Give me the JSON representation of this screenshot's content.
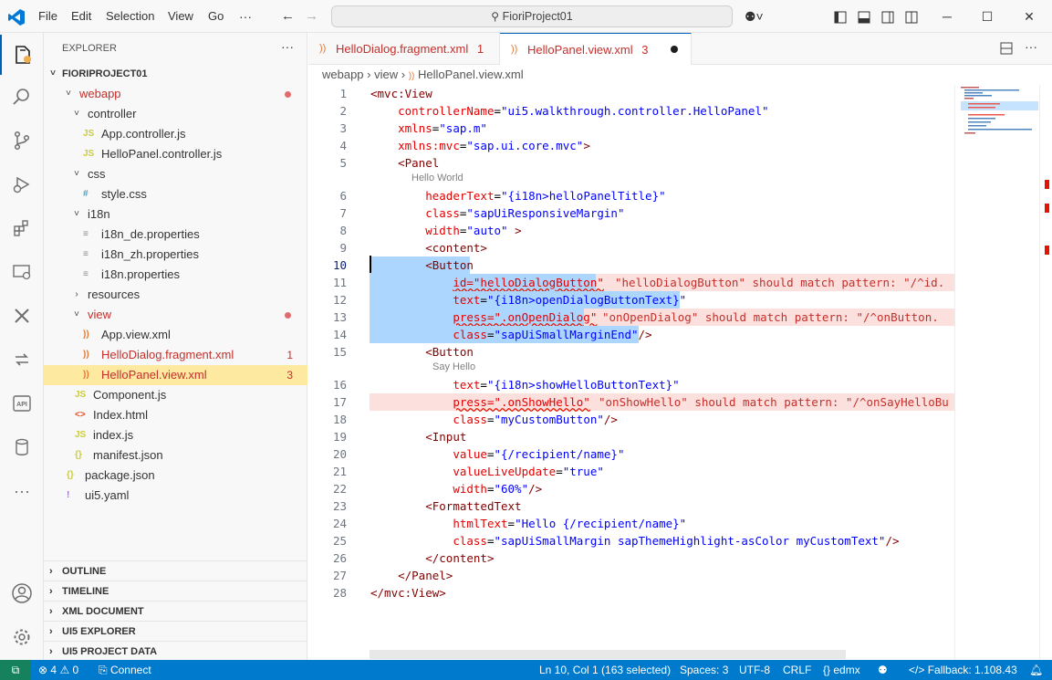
{
  "titlebar": {
    "menu": [
      "File",
      "Edit",
      "Selection",
      "View",
      "Go"
    ],
    "more": "···",
    "search": "FioriProject01"
  },
  "activity_icons": [
    "explorer-icon",
    "search-icon",
    "source-control-icon",
    "run-debug-icon",
    "extensions-icon",
    "remote-explorer-icon",
    "sap-tools-icon",
    "deploy-icon",
    "api-icon",
    "database-icon",
    "more-icon",
    "account-icon",
    "settings-icon"
  ],
  "sidebar": {
    "title": "EXPLORER",
    "project": "FIORIPROJECT01",
    "tree": [
      {
        "label": "webapp",
        "type": "folder",
        "open": true,
        "depth": 1,
        "color": "#c4302b",
        "dot": true
      },
      {
        "label": "controller",
        "type": "folder",
        "open": true,
        "depth": 2
      },
      {
        "label": "App.controller.js",
        "type": "js",
        "depth": 3
      },
      {
        "label": "HelloPanel.controller.js",
        "type": "js",
        "depth": 3
      },
      {
        "label": "css",
        "type": "folder",
        "open": true,
        "depth": 2
      },
      {
        "label": "style.css",
        "type": "css",
        "depth": 3
      },
      {
        "label": "i18n",
        "type": "folder",
        "open": true,
        "depth": 2
      },
      {
        "label": "i18n_de.properties",
        "type": "prop",
        "depth": 3
      },
      {
        "label": "i18n_zh.properties",
        "type": "prop",
        "depth": 3
      },
      {
        "label": "i18n.properties",
        "type": "prop",
        "depth": 3
      },
      {
        "label": "resources",
        "type": "folder",
        "open": false,
        "depth": 2
      },
      {
        "label": "view",
        "type": "folder",
        "open": true,
        "depth": 2,
        "color": "#c4302b",
        "dot": true
      },
      {
        "label": "App.view.xml",
        "type": "xml",
        "depth": 3
      },
      {
        "label": "HelloDialog.fragment.xml",
        "type": "xml",
        "depth": 3,
        "color": "#c4302b",
        "badge": "1"
      },
      {
        "label": "HelloPanel.view.xml",
        "type": "xml",
        "depth": 3,
        "color": "#c4302b",
        "badge": "3",
        "selected": true
      },
      {
        "label": "Component.js",
        "type": "js",
        "depth": 2
      },
      {
        "label": "Index.html",
        "type": "html",
        "depth": 2
      },
      {
        "label": "index.js",
        "type": "js",
        "depth": 2
      },
      {
        "label": "manifest.json",
        "type": "json",
        "depth": 2
      },
      {
        "label": "package.json",
        "type": "json",
        "depth": 1
      },
      {
        "label": "ui5.yaml",
        "type": "yaml",
        "depth": 1
      }
    ],
    "panels": [
      "OUTLINE",
      "TIMELINE",
      "XML DOCUMENT",
      "UI5 EXPLORER",
      "UI5 PROJECT DATA"
    ]
  },
  "tabs": [
    {
      "label": "HelloDialog.fragment.xml",
      "badge": "1",
      "active": false
    },
    {
      "label": "HelloPanel.view.xml",
      "badge": "3",
      "active": true,
      "dirty": true
    }
  ],
  "breadcrumb": [
    "webapp",
    "view",
    "HelloPanel.view.xml"
  ],
  "code": {
    "lines": [
      {
        "n": "1",
        "parts": [
          [
            "t",
            "<mvc:View"
          ]
        ]
      },
      {
        "n": "2",
        "parts": [
          [
            "x",
            "    "
          ],
          [
            "a",
            "controllerName"
          ],
          [
            "x",
            "="
          ],
          [
            "v",
            "\"ui5.walkthrough.controller.HelloPanel\""
          ]
        ]
      },
      {
        "n": "3",
        "parts": [
          [
            "x",
            "    "
          ],
          [
            "a",
            "xmlns"
          ],
          [
            "x",
            "="
          ],
          [
            "v",
            "\"sap.m\""
          ]
        ]
      },
      {
        "n": "4",
        "parts": [
          [
            "x",
            "    "
          ],
          [
            "a",
            "xmlns:mvc"
          ],
          [
            "x",
            "="
          ],
          [
            "v",
            "\"sap.ui.core.mvc\""
          ],
          [
            "t",
            ">"
          ]
        ]
      },
      {
        "n": "5",
        "parts": [
          [
            "x",
            "    "
          ],
          [
            "t",
            "<Panel"
          ]
        ]
      },
      {
        "hint": "Hello World"
      },
      {
        "n": "6",
        "parts": [
          [
            "x",
            "        "
          ],
          [
            "a",
            "headerText"
          ],
          [
            "x",
            "="
          ],
          [
            "v",
            "\"{i18n>helloPanelTitle}\""
          ]
        ]
      },
      {
        "n": "7",
        "parts": [
          [
            "x",
            "        "
          ],
          [
            "a",
            "class"
          ],
          [
            "x",
            "="
          ],
          [
            "v",
            "\"sapUiResponsiveMargin\""
          ]
        ]
      },
      {
        "n": "8",
        "parts": [
          [
            "x",
            "        "
          ],
          [
            "a",
            "width"
          ],
          [
            "x",
            "="
          ],
          [
            "v",
            "\"auto\""
          ],
          [
            "x",
            " "
          ],
          [
            "t",
            ">"
          ]
        ]
      },
      {
        "n": "9",
        "parts": [
          [
            "x",
            "        "
          ],
          [
            "t",
            "<content>"
          ]
        ]
      },
      {
        "n": "10",
        "parts": [
          [
            "x",
            "        "
          ],
          [
            "t",
            "<Button"
          ]
        ],
        "sel": true,
        "cur": true
      },
      {
        "n": "11",
        "parts": [
          [
            "x",
            "            "
          ],
          [
            "sq",
            "id=\"helloDialogButton\""
          ]
        ],
        "sel": true,
        "err": true,
        "msg": "\"helloDialogButton\" should match pattern: \"/^id."
      },
      {
        "n": "12",
        "parts": [
          [
            "x",
            "            "
          ],
          [
            "a",
            "text"
          ],
          [
            "x",
            "="
          ],
          [
            "v",
            "\"{i18n>openDialogButtonText}\""
          ]
        ],
        "sel": true
      },
      {
        "n": "13",
        "parts": [
          [
            "x",
            "            "
          ],
          [
            "sq",
            "press=\".onOpenDialog\""
          ]
        ],
        "sel": true,
        "err": true,
        "msg": "\"onOpenDialog\" should match pattern: \"/^onButton."
      },
      {
        "n": "14",
        "parts": [
          [
            "x",
            "            "
          ],
          [
            "a",
            "class"
          ],
          [
            "x",
            "="
          ],
          [
            "v",
            "\"sapUiSmallMarginEnd\""
          ],
          [
            "t",
            "/>"
          ]
        ],
        "sel": true
      },
      {
        "n": "15",
        "parts": [
          [
            "x",
            "        "
          ],
          [
            "t",
            "<Button"
          ]
        ]
      },
      {
        "hint": "Say Hello",
        "indent": true
      },
      {
        "n": "16",
        "parts": [
          [
            "x",
            "            "
          ],
          [
            "a",
            "text"
          ],
          [
            "x",
            "="
          ],
          [
            "v",
            "\"{i18n>showHelloButtonText}\""
          ]
        ]
      },
      {
        "n": "17",
        "parts": [
          [
            "x",
            "            "
          ],
          [
            "sq",
            "press=\".onShowHello\""
          ]
        ],
        "err": true,
        "msg": "\"onShowHello\" should match pattern: \"/^onSayHelloBu"
      },
      {
        "n": "18",
        "parts": [
          [
            "x",
            "            "
          ],
          [
            "a",
            "class"
          ],
          [
            "x",
            "="
          ],
          [
            "v",
            "\"myCustomButton\""
          ],
          [
            "t",
            "/>"
          ]
        ]
      },
      {
        "n": "19",
        "parts": [
          [
            "x",
            "        "
          ],
          [
            "t",
            "<Input"
          ]
        ]
      },
      {
        "n": "20",
        "parts": [
          [
            "x",
            "            "
          ],
          [
            "a",
            "value"
          ],
          [
            "x",
            "="
          ],
          [
            "v",
            "\"{/recipient/name}\""
          ]
        ]
      },
      {
        "n": "21",
        "parts": [
          [
            "x",
            "            "
          ],
          [
            "a",
            "valueLiveUpdate"
          ],
          [
            "x",
            "="
          ],
          [
            "v",
            "\"true\""
          ]
        ]
      },
      {
        "n": "22",
        "parts": [
          [
            "x",
            "            "
          ],
          [
            "a",
            "width"
          ],
          [
            "x",
            "="
          ],
          [
            "v",
            "\"60%\""
          ],
          [
            "t",
            "/>"
          ]
        ]
      },
      {
        "n": "23",
        "parts": [
          [
            "x",
            "        "
          ],
          [
            "t",
            "<FormattedText"
          ]
        ]
      },
      {
        "n": "24",
        "parts": [
          [
            "x",
            "            "
          ],
          [
            "a",
            "htmlText"
          ],
          [
            "x",
            "="
          ],
          [
            "v",
            "\"Hello {/recipient/name}\""
          ]
        ]
      },
      {
        "n": "25",
        "parts": [
          [
            "x",
            "            "
          ],
          [
            "a",
            "class"
          ],
          [
            "x",
            "="
          ],
          [
            "v",
            "\"sapUiSmallMargin sapThemeHighlight-asColor myCustomText\""
          ],
          [
            "t",
            "/>"
          ]
        ]
      },
      {
        "n": "26",
        "parts": [
          [
            "x",
            "        "
          ],
          [
            "t",
            "</content>"
          ]
        ]
      },
      {
        "n": "27",
        "parts": [
          [
            "x",
            "    "
          ],
          [
            "t",
            "</Panel>"
          ]
        ]
      },
      {
        "n": "28",
        "parts": [
          [
            "t",
            "</mvc:View>"
          ]
        ]
      }
    ]
  },
  "statusbar": {
    "errors": "4",
    "warnings": "0",
    "connect": "Connect",
    "position": "Ln 10, Col 1 (163 selected)",
    "spaces": "Spaces: 3",
    "encoding": "UTF-8",
    "eol": "CRLF",
    "language": "edmx",
    "fallback": "Fallback: 1.108.43"
  },
  "colors": {
    "accent": "#007acc",
    "error": "#c4302b",
    "selection": "#add6ff",
    "selected_file": "#fde9a0"
  }
}
